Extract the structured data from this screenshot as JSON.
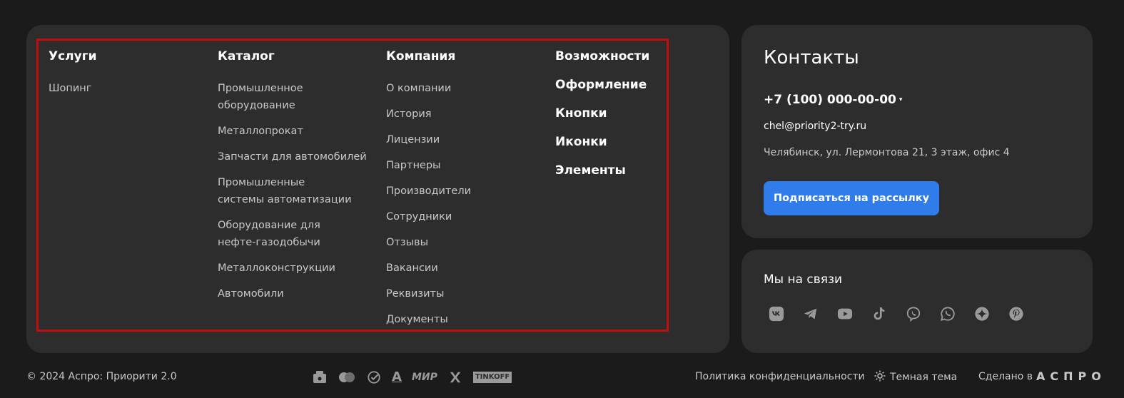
{
  "menu": {
    "columns": [
      {
        "title": "Услуги",
        "items": [
          "Шопинг"
        ]
      },
      {
        "title": "Каталог",
        "items": [
          "Промышленное оборудование",
          "Металлопрокат",
          "Запчасти для автомобилей",
          "Промышленные системы автоматизации",
          "Оборудование для нефте-газодобычи",
          "Металлоконструкции",
          "Автомобили"
        ]
      },
      {
        "title": "Компания",
        "items": [
          "О компании",
          "История",
          "Лицензии",
          "Партнеры",
          "Производители",
          "Сотрудники",
          "Отзывы",
          "Вакансии",
          "Реквизиты",
          "Документы"
        ]
      },
      {
        "title": "Возможности",
        "items": [
          "Оформление",
          "Кнопки",
          "Иконки",
          "Элементы"
        ]
      }
    ]
  },
  "contacts": {
    "title": "Контакты",
    "phone": "+7 (100) 000-00-00",
    "email": "chel@priority2-try.ru",
    "address": "Челябинск, ул. Лермонтова 21, 3 этаж, офис 4",
    "subscribe_label": "Подписаться на рассылку"
  },
  "social": {
    "title": "Мы на связи",
    "icons": [
      "vk-icon",
      "telegram-icon",
      "youtube-icon",
      "tiktok-icon",
      "viber-icon",
      "whatsapp-icon",
      "zen-icon",
      "pinterest-icon"
    ]
  },
  "footer": {
    "copyright": "© 2024 Аспро: Приорити 2.0",
    "payments": {
      "a": "A",
      "mir": "МИР",
      "tinkoff": "TINKOFF"
    },
    "policy": "Политика конфиденциальности",
    "theme": "Темная тема",
    "madeby": "Сделано в",
    "brand": "АСПРО"
  },
  "colors": {
    "accent": "#2f7cea",
    "highlight": "#c20e0e",
    "card": "#2d2d2d",
    "background": "#1b1b1b"
  }
}
